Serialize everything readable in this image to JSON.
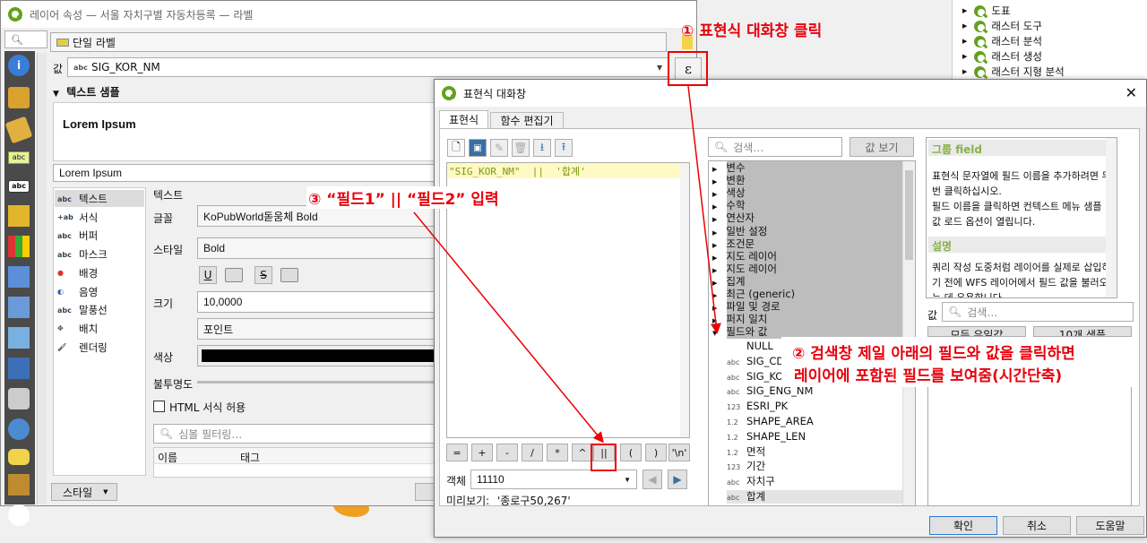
{
  "layer_win": {
    "title": "레이어 속성 — 서울 자치구별 자동차등록 — 라벨",
    "label_mode": "단일 라벨",
    "value_label": "값",
    "value_field": "SIG_KOR_NM",
    "text_sample_header": "텍스트 샘플",
    "sample_text": "Lorem Ipsum",
    "sample_input": "Lorem Ipsum",
    "categories": [
      "텍스트",
      "서식",
      "버퍼",
      "마스크",
      "배경",
      "음영",
      "말풍선",
      "배치",
      "렌더링"
    ],
    "section_title": "텍스트",
    "font_label": "글꼴",
    "font_value": "KoPubWorld돋움체 Bold",
    "style_label": "스타일",
    "style_value": "Bold",
    "size_label": "크기",
    "size_value": "10,0000",
    "unit_value": "포인트",
    "color_label": "색상",
    "opacity_label": "불투명도",
    "html_label": "HTML 서식 허용",
    "symbol_filter_placeholder": "심볼 필터링…",
    "col_name": "이름",
    "col_tag": "태그",
    "style_button": "스타일"
  },
  "right_tree": [
    "도표",
    "래스터 도구",
    "래스터 분석",
    "래스터 생성",
    "래스터 지형 분석"
  ],
  "expr_win": {
    "title": "표현식 대화창",
    "tabs": [
      "표현식",
      "함수 편집기"
    ],
    "expression": "\"SIG_KOR_NM\"  ||  '합계'",
    "operators": [
      "=",
      "+",
      "-",
      "/",
      "*",
      "^",
      "||",
      "(",
      ")",
      "'\\n'"
    ],
    "feature_label": "객체",
    "feature_value": "11110",
    "preview_label": "미리보기:",
    "preview_value": "'종로구50,267'",
    "search_placeholder": "검색…",
    "show_values": "값 보기",
    "groups": [
      "변수",
      "변환",
      "색상",
      "수학",
      "연산자",
      "일반 설정",
      "조건문",
      "지도 레이어",
      "지도 레이어",
      "집계",
      "최근 (generic)",
      "파일 및 경로",
      "퍼지 일치",
      "필드와 값"
    ],
    "fields": [
      {
        "t": "",
        "n": "NULL"
      },
      {
        "t": "abc",
        "n": "SIG_CD"
      },
      {
        "t": "abc",
        "n": "SIG_KOR_NM"
      },
      {
        "t": "abc",
        "n": "SIG_ENG_NM"
      },
      {
        "t": "123",
        "n": "ESRI_PK"
      },
      {
        "t": "1.2",
        "n": "SHAPE_AREA"
      },
      {
        "t": "1.2",
        "n": "SHAPE_LEN"
      },
      {
        "t": "1.2",
        "n": "면적"
      },
      {
        "t": "123",
        "n": "기간"
      },
      {
        "t": "abc",
        "n": "자치구"
      },
      {
        "t": "abc",
        "n": "합계"
      }
    ],
    "help_title": "그룹 field",
    "help_text": "표현식 문자열에 필드 이름을 추가하려면 두 번 클릭하십시오.\n필드 이름을 클릭하면 컨텍스트 메뉴 샘플 값 로드 옵션이 열립니다.",
    "desc_title": "설명",
    "desc_text": "쿼리 작성 도중처럼 레이어를 실제로 삽입하기 전에 WFS 레이어에서 필드 값을 불러오는 데 유용합니다.",
    "values_label": "값",
    "values_search": "검색…",
    "all_unique": "모든 유일값",
    "ten_samples": "10개 샘플",
    "ok": "확인",
    "cancel": "취소",
    "help": "도움말"
  },
  "annotations": {
    "a1": "① 표현식 대화창 클릭",
    "a2_line1": "② 검색창 제일 아래의 필드와 값을 클릭하면",
    "a2_line2": "레이어에 포함된 필드를 보여줌(시간단축)",
    "a3": "③ “필드1” || “필드2” 입력"
  }
}
